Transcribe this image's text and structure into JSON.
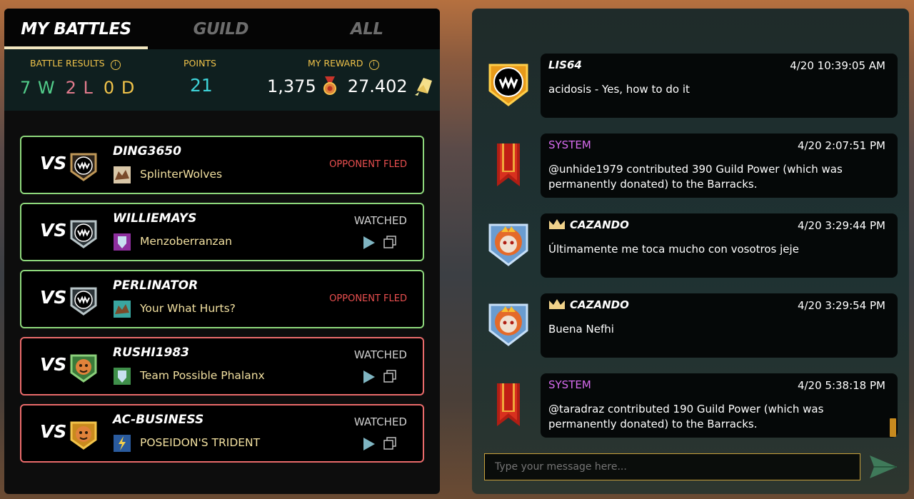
{
  "tabs": [
    {
      "label": "MY BATTLES",
      "active": true
    },
    {
      "label": "GUILD",
      "active": false
    },
    {
      "label": "ALL",
      "active": false
    }
  ],
  "stats": {
    "battle_results_label": "BATTLE RESULTS",
    "wins": "7 W",
    "losses": "2 L",
    "draws": "0 D",
    "points_label": "POINTS",
    "points": "21",
    "reward_label": "MY REWARD",
    "reward_merits": "1,375",
    "reward_crowns": "27.402"
  },
  "battles": [
    {
      "vs": "VS",
      "opponent": "DING3650",
      "guild": "SplinterWolves",
      "status": "OPPONENT FLED",
      "result": "win"
    },
    {
      "vs": "VS",
      "opponent": "WILLIEMAYS",
      "guild": "Menzoberranzan",
      "status": "WATCHED",
      "result": "win"
    },
    {
      "vs": "VS",
      "opponent": "PERLINATOR",
      "guild": "Your What Hurts?",
      "status": "OPPONENT FLED",
      "result": "win"
    },
    {
      "vs": "VS",
      "opponent": "RUSHI1983",
      "guild": "Team Possible Phalanx",
      "status": "WATCHED",
      "result": "loss"
    },
    {
      "vs": "VS",
      "opponent": "AC-BUSINESS",
      "guild": "POSEIDON'S TRIDENT",
      "status": "WATCHED",
      "result": "loss"
    }
  ],
  "chat": {
    "messages": [
      {
        "name": "LIS64",
        "time": "4/20 10:39:05 AM",
        "text": "acidosis - Yes, how to do it",
        "type": "user"
      },
      {
        "name": "SYSTEM",
        "time": "4/20 2:07:51 PM",
        "text": "@unhide1979 contributed 390 Guild Power (which was permanently donated) to the Barracks.",
        "type": "system"
      },
      {
        "name": "CAZANDO",
        "time": "4/20 3:29:44 PM",
        "text": "Últimamente me toca mucho con vosotros jeje",
        "type": "crown"
      },
      {
        "name": "CAZANDO",
        "time": "4/20 3:29:54 PM",
        "text": "Buena Nefhi",
        "type": "crown"
      },
      {
        "name": "SYSTEM",
        "time": "4/20 5:38:18 PM",
        "text": "@taradraz contributed 190 Guild Power (which was permanently donated) to the Barracks.",
        "type": "system"
      }
    ],
    "input_placeholder": "Type your message here..."
  },
  "colors": {
    "win_border": "#8ed87c",
    "loss_border": "#ea6b6b",
    "accent_gold": "#f0c34a",
    "system_purple": "#d86bf0"
  }
}
